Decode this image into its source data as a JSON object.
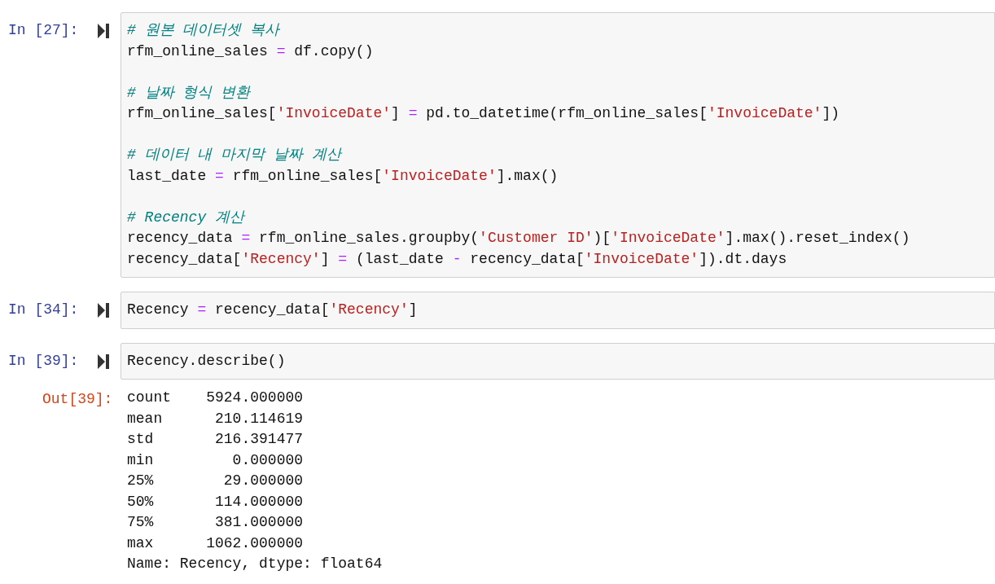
{
  "cells": [
    {
      "prompt": "In [27]:",
      "lines": [
        {
          "kind": "code",
          "tokens": [
            {
              "kind": "comment",
              "text": "# 원본 데이터셋 복사"
            }
          ]
        },
        {
          "kind": "code",
          "tokens": [
            {
              "kind": "text",
              "text": "rfm_online_sales "
            },
            {
              "kind": "op",
              "text": "="
            },
            {
              "kind": "text",
              "text": " df.copy()"
            }
          ]
        },
        {
          "kind": "blank"
        },
        {
          "kind": "code",
          "tokens": [
            {
              "kind": "comment",
              "text": "# 날짜 형식 변환"
            }
          ]
        },
        {
          "kind": "code",
          "tokens": [
            {
              "kind": "text",
              "text": "rfm_online_sales["
            },
            {
              "kind": "string",
              "text": "'InvoiceDate'"
            },
            {
              "kind": "text",
              "text": "] "
            },
            {
              "kind": "op",
              "text": "="
            },
            {
              "kind": "text",
              "text": " pd.to_datetime(rfm_online_sales["
            },
            {
              "kind": "string",
              "text": "'InvoiceDate'"
            },
            {
              "kind": "text",
              "text": "])"
            }
          ]
        },
        {
          "kind": "blank"
        },
        {
          "kind": "code",
          "tokens": [
            {
              "kind": "comment",
              "text": "# 데이터 내 마지막 날짜 계산"
            }
          ]
        },
        {
          "kind": "code",
          "tokens": [
            {
              "kind": "text",
              "text": "last_date "
            },
            {
              "kind": "op",
              "text": "="
            },
            {
              "kind": "text",
              "text": " rfm_online_sales["
            },
            {
              "kind": "string",
              "text": "'InvoiceDate'"
            },
            {
              "kind": "text",
              "text": "].max()"
            }
          ]
        },
        {
          "kind": "blank"
        },
        {
          "kind": "code",
          "tokens": [
            {
              "kind": "comment",
              "text": "# Recency 계산"
            }
          ]
        },
        {
          "kind": "code",
          "tokens": [
            {
              "kind": "text",
              "text": "recency_data "
            },
            {
              "kind": "op",
              "text": "="
            },
            {
              "kind": "text",
              "text": " rfm_online_sales.groupby("
            },
            {
              "kind": "string",
              "text": "'Customer ID'"
            },
            {
              "kind": "text",
              "text": ")["
            },
            {
              "kind": "string",
              "text": "'InvoiceDate'"
            },
            {
              "kind": "text",
              "text": "].max().reset_index()"
            }
          ]
        },
        {
          "kind": "code",
          "tokens": [
            {
              "kind": "text",
              "text": "recency_data["
            },
            {
              "kind": "string",
              "text": "'Recency'"
            },
            {
              "kind": "text",
              "text": "] "
            },
            {
              "kind": "op",
              "text": "="
            },
            {
              "kind": "text",
              "text": " (last_date "
            },
            {
              "kind": "op",
              "text": "-"
            },
            {
              "kind": "text",
              "text": " recency_data["
            },
            {
              "kind": "string",
              "text": "'InvoiceDate'"
            },
            {
              "kind": "text",
              "text": "]).dt.days"
            }
          ]
        }
      ]
    },
    {
      "prompt": "In [34]:",
      "lines": [
        {
          "kind": "code",
          "tokens": [
            {
              "kind": "text",
              "text": "Recency "
            },
            {
              "kind": "op",
              "text": "="
            },
            {
              "kind": "text",
              "text": " recency_data["
            },
            {
              "kind": "string",
              "text": "'Recency'"
            },
            {
              "kind": "text",
              "text": "]"
            }
          ]
        }
      ]
    },
    {
      "prompt": "In [39]:",
      "lines": [
        {
          "kind": "code",
          "tokens": [
            {
              "kind": "text",
              "text": "Recency.describe()"
            }
          ]
        }
      ],
      "output": {
        "prompt": "Out[39]:",
        "lines": [
          "count    5924.000000",
          "mean      210.114619",
          "std       216.391477",
          "min         0.000000",
          "25%        29.000000",
          "50%       114.000000",
          "75%       381.000000",
          "max      1062.000000",
          "Name: Recency, dtype: float64"
        ]
      }
    }
  ]
}
